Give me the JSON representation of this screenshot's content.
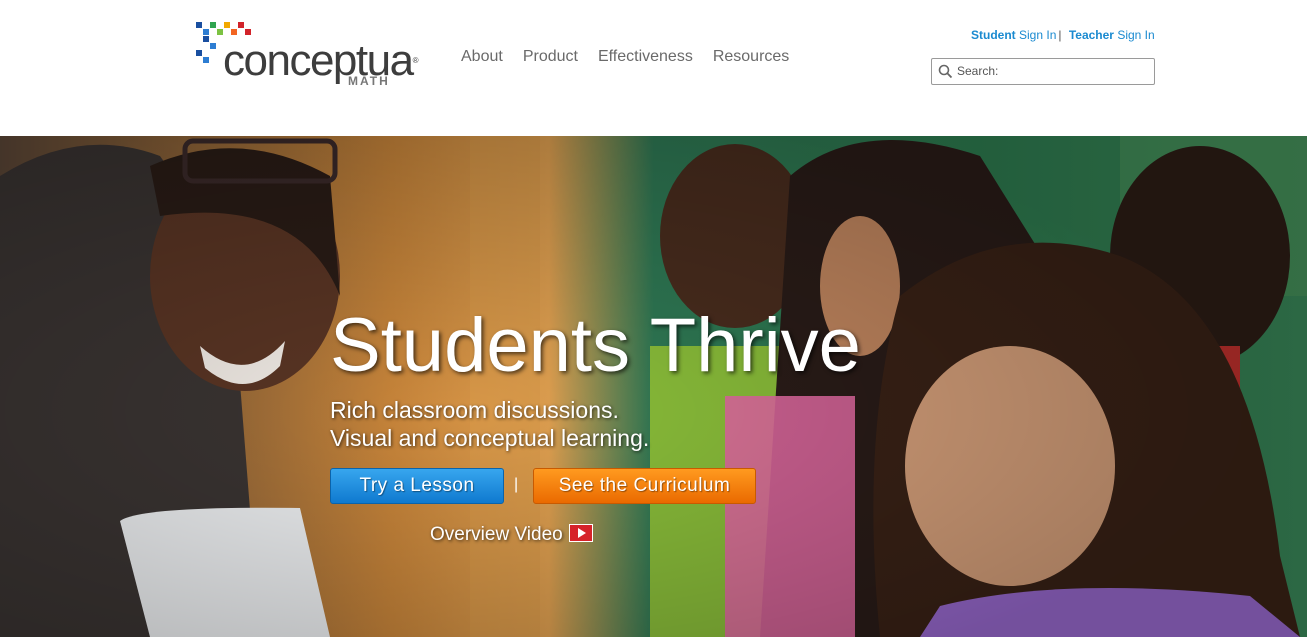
{
  "brand": {
    "logo_word": "conceptua",
    "logo_mark": "®",
    "logo_sub": "MATH",
    "dot_colors": [
      "#1a4fa0",
      "#2d7dd2",
      "#2fa44f",
      "#f2a900",
      "#d2232a"
    ]
  },
  "nav": {
    "items": [
      "About",
      "Product",
      "Effectiveness",
      "Resources"
    ]
  },
  "signin": {
    "student_bold": "Student",
    "student_rest": " Sign In",
    "separator": "|",
    "teacher_bold": "Teacher",
    "teacher_rest": " Sign In"
  },
  "search": {
    "placeholder": "Search:",
    "icon": "search-icon"
  },
  "hero": {
    "title": "Students Thrive",
    "subtitle_line1": "Rich classroom discussions.",
    "subtitle_line2": "Visual and conceptual learning.",
    "primary_button": "Try a Lesson",
    "button_separator": "|",
    "secondary_button": "See the Curriculum",
    "video_link": "Overview Video",
    "video_icon": "play-icon",
    "colors": {
      "primary_button": "#1a8ad0",
      "secondary_button": "#f27a0c",
      "link": "#1a8ad0"
    }
  }
}
